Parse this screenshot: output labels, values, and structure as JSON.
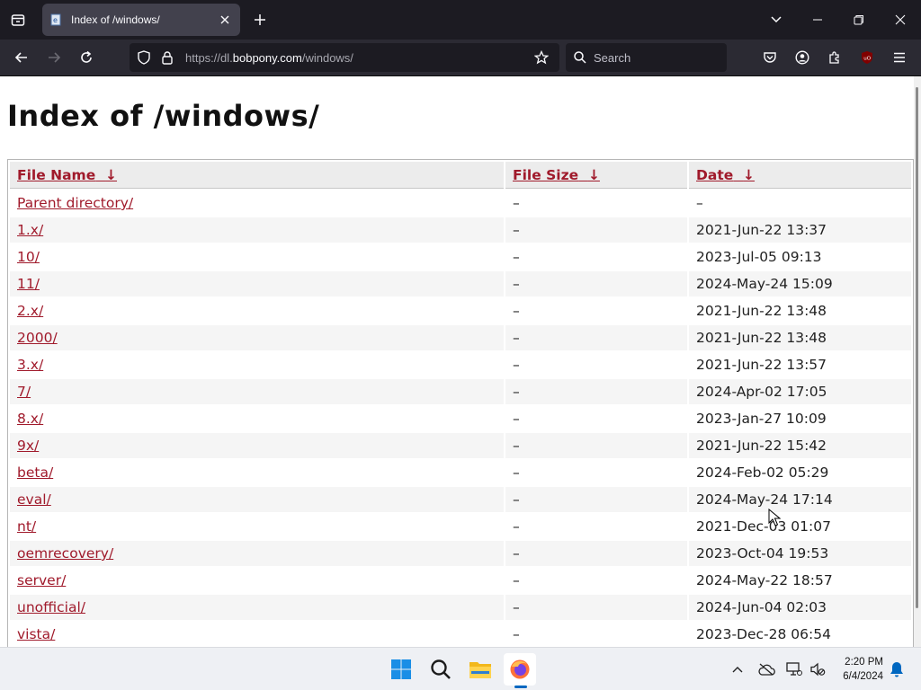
{
  "browser": {
    "tab": {
      "title": "Index of /windows/"
    },
    "url": {
      "prefix": "https://dl.",
      "host": "bobpony.com",
      "path": "/windows/"
    },
    "search": {
      "placeholder": "Search"
    }
  },
  "page": {
    "title": "Index of /windows/",
    "columns": [
      {
        "label": "File Name",
        "sort_icon": "↓"
      },
      {
        "label": "File Size",
        "sort_icon": "↓"
      },
      {
        "label": "Date",
        "sort_icon": "↓"
      }
    ],
    "rows": [
      {
        "name": "Parent directory/",
        "size": "–",
        "date": "–"
      },
      {
        "name": "1.x/",
        "size": "–",
        "date": "2021-Jun-22 13:37"
      },
      {
        "name": "10/",
        "size": "–",
        "date": "2023-Jul-05 09:13"
      },
      {
        "name": "11/",
        "size": "–",
        "date": "2024-May-24 15:09"
      },
      {
        "name": "2.x/",
        "size": "–",
        "date": "2021-Jun-22 13:48"
      },
      {
        "name": "2000/",
        "size": "–",
        "date": "2021-Jun-22 13:48"
      },
      {
        "name": "3.x/",
        "size": "–",
        "date": "2021-Jun-22 13:57"
      },
      {
        "name": "7/",
        "size": "–",
        "date": "2024-Apr-02 17:05"
      },
      {
        "name": "8.x/",
        "size": "–",
        "date": "2023-Jan-27 10:09"
      },
      {
        "name": "9x/",
        "size": "–",
        "date": "2021-Jun-22 15:42"
      },
      {
        "name": "beta/",
        "size": "–",
        "date": "2024-Feb-02 05:29"
      },
      {
        "name": "eval/",
        "size": "–",
        "date": "2024-May-24 17:14"
      },
      {
        "name": "nt/",
        "size": "–",
        "date": "2021-Dec-03 01:07"
      },
      {
        "name": "oemrecovery/",
        "size": "–",
        "date": "2023-Oct-04 19:53"
      },
      {
        "name": "server/",
        "size": "–",
        "date": "2024-May-22 18:57"
      },
      {
        "name": "unofficial/",
        "size": "–",
        "date": "2024-Jun-04 02:03"
      },
      {
        "name": "vista/",
        "size": "–",
        "date": "2023-Dec-28 06:54"
      }
    ]
  },
  "taskbar": {
    "apps": [
      "start-icon",
      "search-icon",
      "file-explorer-icon",
      "firefox-icon"
    ],
    "clock": {
      "time": "2:20 PM",
      "date": "6/4/2024"
    }
  },
  "colors": {
    "link": "#a01a2b",
    "tabstrip": "#1c1b22",
    "toolbar": "#2b2a33"
  }
}
